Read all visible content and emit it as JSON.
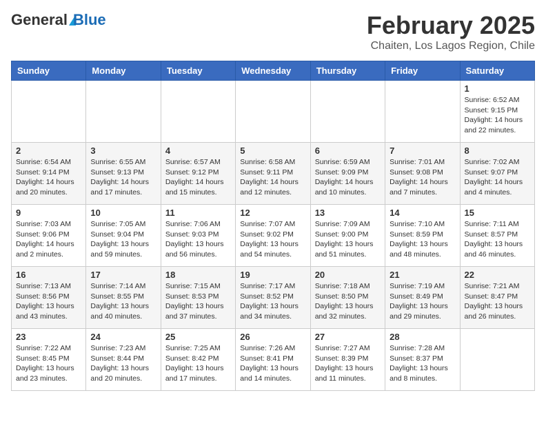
{
  "logo": {
    "general": "General",
    "blue": "Blue"
  },
  "title": "February 2025",
  "location": "Chaiten, Los Lagos Region, Chile",
  "days_of_week": [
    "Sunday",
    "Monday",
    "Tuesday",
    "Wednesday",
    "Thursday",
    "Friday",
    "Saturday"
  ],
  "weeks": [
    [
      {
        "day": "",
        "info": ""
      },
      {
        "day": "",
        "info": ""
      },
      {
        "day": "",
        "info": ""
      },
      {
        "day": "",
        "info": ""
      },
      {
        "day": "",
        "info": ""
      },
      {
        "day": "",
        "info": ""
      },
      {
        "day": "1",
        "info": "Sunrise: 6:52 AM\nSunset: 9:15 PM\nDaylight: 14 hours and 22 minutes."
      }
    ],
    [
      {
        "day": "2",
        "info": "Sunrise: 6:54 AM\nSunset: 9:14 PM\nDaylight: 14 hours and 20 minutes."
      },
      {
        "day": "3",
        "info": "Sunrise: 6:55 AM\nSunset: 9:13 PM\nDaylight: 14 hours and 17 minutes."
      },
      {
        "day": "4",
        "info": "Sunrise: 6:57 AM\nSunset: 9:12 PM\nDaylight: 14 hours and 15 minutes."
      },
      {
        "day": "5",
        "info": "Sunrise: 6:58 AM\nSunset: 9:11 PM\nDaylight: 14 hours and 12 minutes."
      },
      {
        "day": "6",
        "info": "Sunrise: 6:59 AM\nSunset: 9:09 PM\nDaylight: 14 hours and 10 minutes."
      },
      {
        "day": "7",
        "info": "Sunrise: 7:01 AM\nSunset: 9:08 PM\nDaylight: 14 hours and 7 minutes."
      },
      {
        "day": "8",
        "info": "Sunrise: 7:02 AM\nSunset: 9:07 PM\nDaylight: 14 hours and 4 minutes."
      }
    ],
    [
      {
        "day": "9",
        "info": "Sunrise: 7:03 AM\nSunset: 9:06 PM\nDaylight: 14 hours and 2 minutes."
      },
      {
        "day": "10",
        "info": "Sunrise: 7:05 AM\nSunset: 9:04 PM\nDaylight: 13 hours and 59 minutes."
      },
      {
        "day": "11",
        "info": "Sunrise: 7:06 AM\nSunset: 9:03 PM\nDaylight: 13 hours and 56 minutes."
      },
      {
        "day": "12",
        "info": "Sunrise: 7:07 AM\nSunset: 9:02 PM\nDaylight: 13 hours and 54 minutes."
      },
      {
        "day": "13",
        "info": "Sunrise: 7:09 AM\nSunset: 9:00 PM\nDaylight: 13 hours and 51 minutes."
      },
      {
        "day": "14",
        "info": "Sunrise: 7:10 AM\nSunset: 8:59 PM\nDaylight: 13 hours and 48 minutes."
      },
      {
        "day": "15",
        "info": "Sunrise: 7:11 AM\nSunset: 8:57 PM\nDaylight: 13 hours and 46 minutes."
      }
    ],
    [
      {
        "day": "16",
        "info": "Sunrise: 7:13 AM\nSunset: 8:56 PM\nDaylight: 13 hours and 43 minutes."
      },
      {
        "day": "17",
        "info": "Sunrise: 7:14 AM\nSunset: 8:55 PM\nDaylight: 13 hours and 40 minutes."
      },
      {
        "day": "18",
        "info": "Sunrise: 7:15 AM\nSunset: 8:53 PM\nDaylight: 13 hours and 37 minutes."
      },
      {
        "day": "19",
        "info": "Sunrise: 7:17 AM\nSunset: 8:52 PM\nDaylight: 13 hours and 34 minutes."
      },
      {
        "day": "20",
        "info": "Sunrise: 7:18 AM\nSunset: 8:50 PM\nDaylight: 13 hours and 32 minutes."
      },
      {
        "day": "21",
        "info": "Sunrise: 7:19 AM\nSunset: 8:49 PM\nDaylight: 13 hours and 29 minutes."
      },
      {
        "day": "22",
        "info": "Sunrise: 7:21 AM\nSunset: 8:47 PM\nDaylight: 13 hours and 26 minutes."
      }
    ],
    [
      {
        "day": "23",
        "info": "Sunrise: 7:22 AM\nSunset: 8:45 PM\nDaylight: 13 hours and 23 minutes."
      },
      {
        "day": "24",
        "info": "Sunrise: 7:23 AM\nSunset: 8:44 PM\nDaylight: 13 hours and 20 minutes."
      },
      {
        "day": "25",
        "info": "Sunrise: 7:25 AM\nSunset: 8:42 PM\nDaylight: 13 hours and 17 minutes."
      },
      {
        "day": "26",
        "info": "Sunrise: 7:26 AM\nSunset: 8:41 PM\nDaylight: 13 hours and 14 minutes."
      },
      {
        "day": "27",
        "info": "Sunrise: 7:27 AM\nSunset: 8:39 PM\nDaylight: 13 hours and 11 minutes."
      },
      {
        "day": "28",
        "info": "Sunrise: 7:28 AM\nSunset: 8:37 PM\nDaylight: 13 hours and 8 minutes."
      },
      {
        "day": "",
        "info": ""
      }
    ]
  ]
}
